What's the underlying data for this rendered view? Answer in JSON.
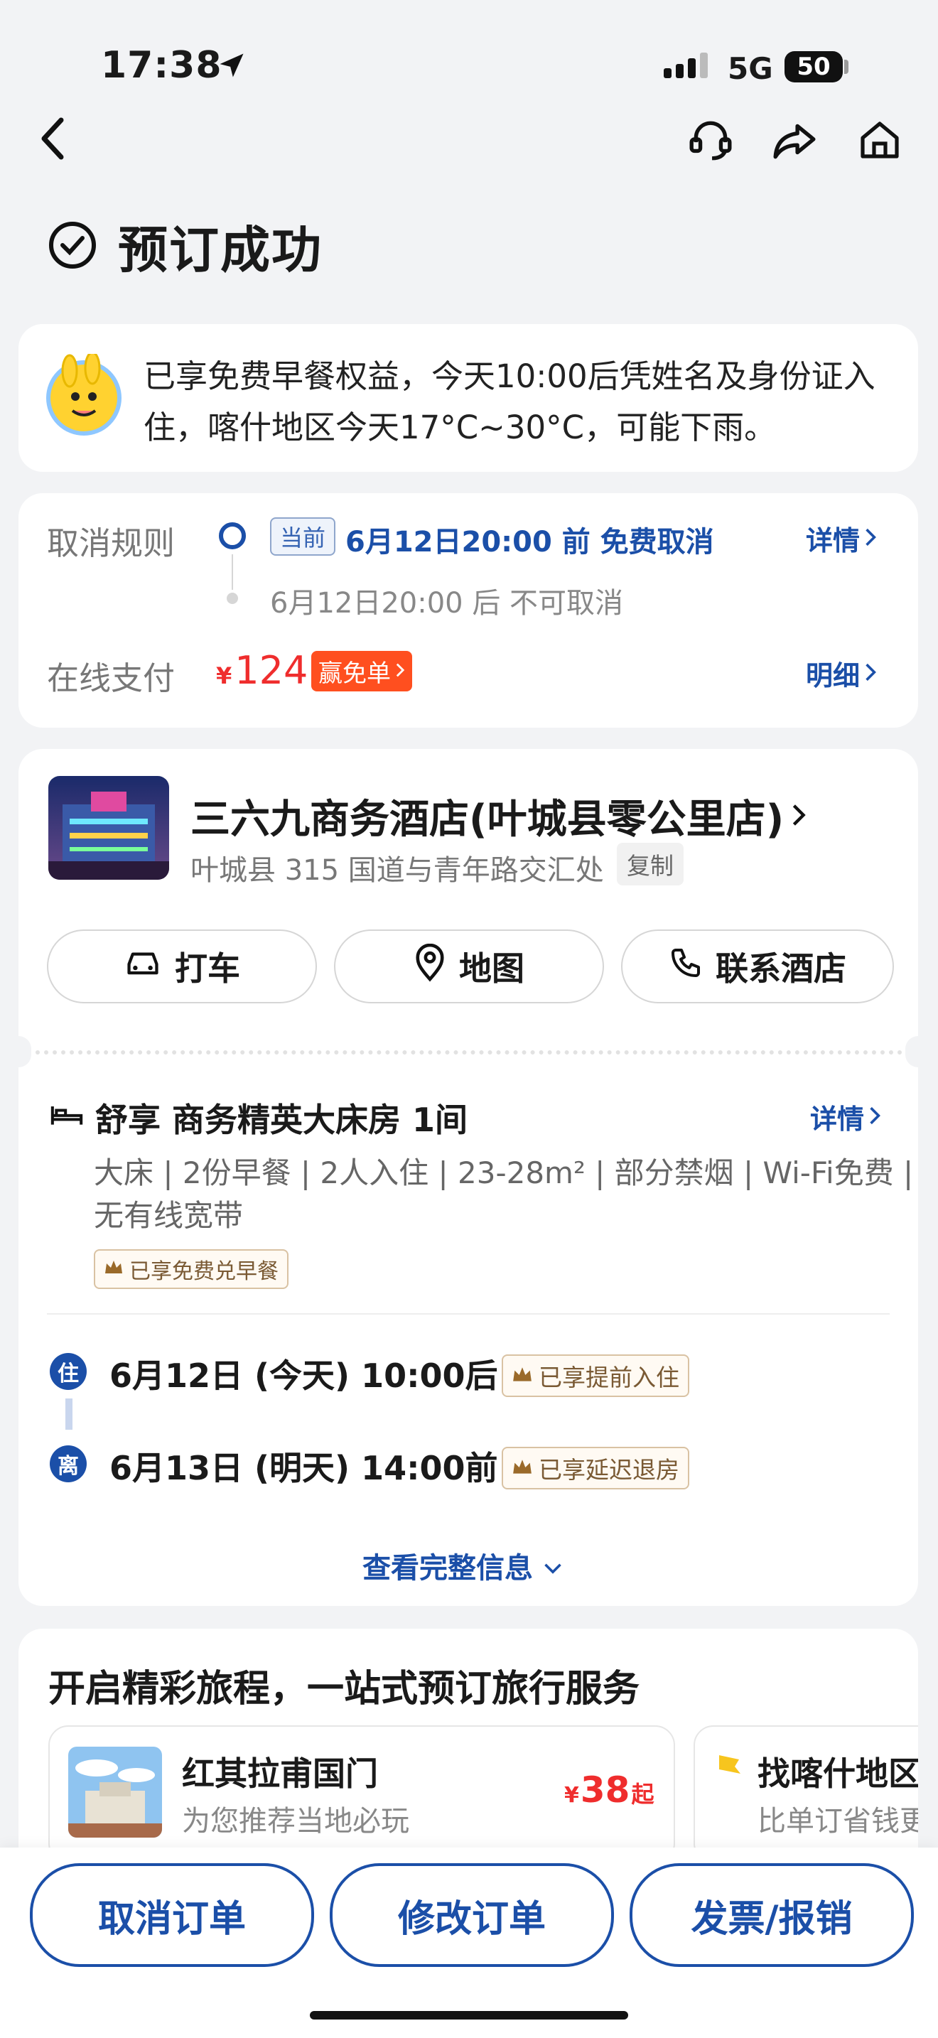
{
  "status_bar": {
    "time": "17:38",
    "network": "5G",
    "battery": "50"
  },
  "page": {
    "title": "预订成功"
  },
  "notice": {
    "text": "已享免费早餐权益，今天10:00后凭姓名及身份证入住，喀什地区今天17°C~30°C，可能下雨。"
  },
  "cancel": {
    "label": "取消规则",
    "current_tag": "当前",
    "rule1": "6月12日20:00 前 免费取消",
    "rule2": "6月12日20:00 后 不可取消",
    "detail_link": "详情"
  },
  "payment": {
    "label": "在线支付",
    "currency": "¥",
    "amount": "124",
    "badge": "赢免单",
    "detail_link": "明细"
  },
  "hotel": {
    "name": "三六九商务酒店(叶城县零公里店)",
    "address": "叶城县 315 国道与青年路交汇处",
    "copy_label": "复制",
    "actions": [
      "打车",
      "地图",
      "联系酒店"
    ]
  },
  "room": {
    "title": "舒享 商务精英大床房 1间",
    "detail_link": "详情",
    "attrs_line1": "大床 | 2份早餐 | 2人入住 | 23-28m² | 部分禁烟 | Wi-Fi免费 |",
    "attrs_line2": "无有线宽带",
    "breakfast_tag": "已享免费兑早餐"
  },
  "stay": {
    "checkin_badge": "住",
    "checkin": "6月12日 (今天) 10:00后",
    "checkin_tag": "已享提前入住",
    "checkout_badge": "离",
    "checkout": "6月13日 (明天) 14:00前",
    "checkout_tag": "已享延迟退房",
    "more_link": "查看完整信息"
  },
  "promo": {
    "title": "开启精彩旅程，一站式预订旅行服务",
    "item1": {
      "name": "红其拉甫国门",
      "sub": "为您推荐当地必玩",
      "currency": "¥",
      "price": "38",
      "suffix": "起"
    },
    "item2": {
      "name": "找喀什地区",
      "sub": "比单订省钱更"
    }
  },
  "bottom": {
    "cancel": "取消订单",
    "modify": "修改订单",
    "invoice": "发票/报销"
  },
  "colors": {
    "brand_blue": "#1b4fa8",
    "price_red": "#ef2d2d",
    "badge_orange": "#ff4f1f"
  }
}
